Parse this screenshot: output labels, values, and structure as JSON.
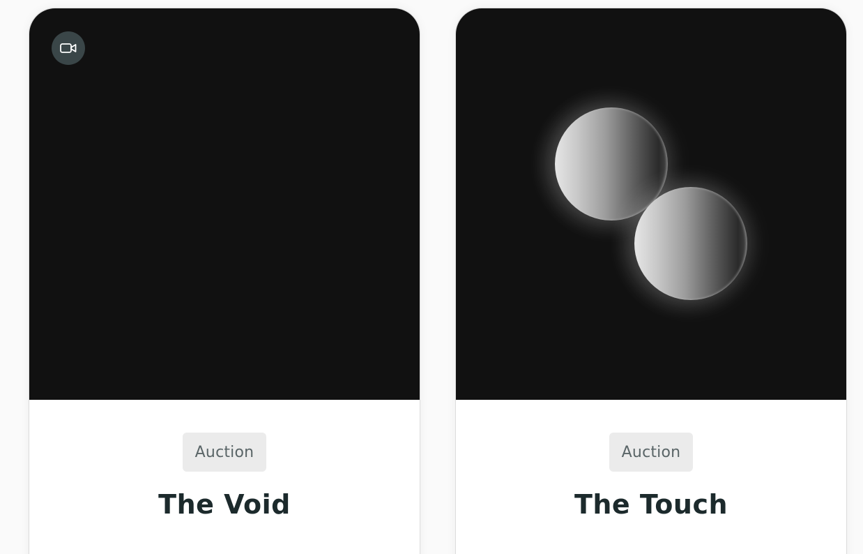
{
  "cards": [
    {
      "media": {
        "type": "video",
        "badge_icon": "video-camera-icon",
        "background": "#111111"
      },
      "tag": "Auction",
      "title": "The Void"
    },
    {
      "media": {
        "type": "image",
        "background": "#111111"
      },
      "tag": "Auction",
      "title": "The Touch"
    }
  ],
  "colors": {
    "card_background": "#ffffff",
    "media_background": "#111111",
    "tag_background": "#ebebeb",
    "tag_text": "#5a6567",
    "title_text": "#1c2a2c",
    "video_badge_background": "#3a4648"
  }
}
